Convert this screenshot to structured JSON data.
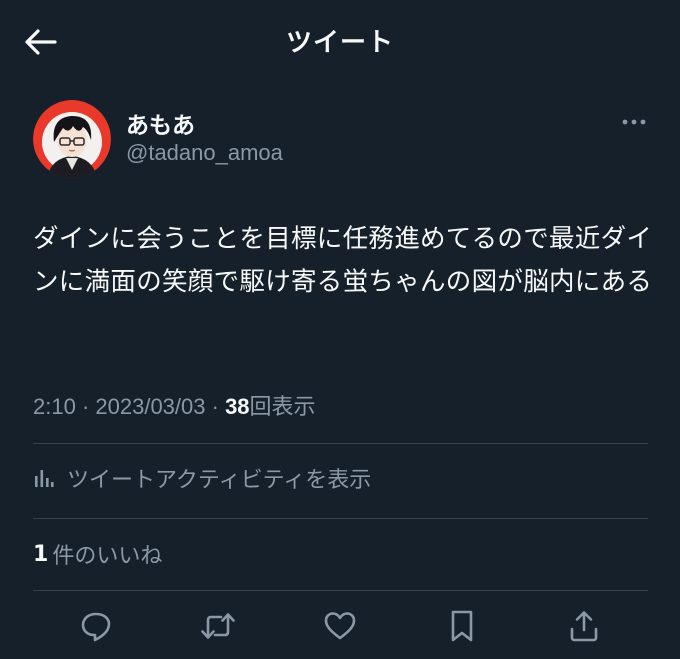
{
  "header": {
    "title": "ツイート",
    "back_icon": "arrow-left-icon"
  },
  "tweet": {
    "author": {
      "display_name": "あもあ",
      "handle": "@tadano_amoa"
    },
    "text": "ダインに会うことを目標に任務進めてるので最近ダインに満面の笑顔で駆け寄る蛍ちゃんの図が脳内にある",
    "time": "2:10",
    "separator": " · ",
    "date": "2023/03/03",
    "views_count": "38",
    "views_label": "回表示",
    "activity_label": "ツイートアクティビティを表示",
    "likes_count": "1",
    "likes_label": "件のいいね"
  },
  "actions": [
    {
      "name": "reply",
      "icon": "reply-icon"
    },
    {
      "name": "retweet",
      "icon": "retweet-icon"
    },
    {
      "name": "like",
      "icon": "heart-icon"
    },
    {
      "name": "bookmark",
      "icon": "bookmark-icon"
    },
    {
      "name": "share",
      "icon": "share-icon"
    }
  ],
  "colors": {
    "background": "#15202b",
    "text_primary": "#f7f9f9",
    "text_secondary": "#8b98a5",
    "divider": "#38444d",
    "avatar_ring": "#e8392b"
  }
}
